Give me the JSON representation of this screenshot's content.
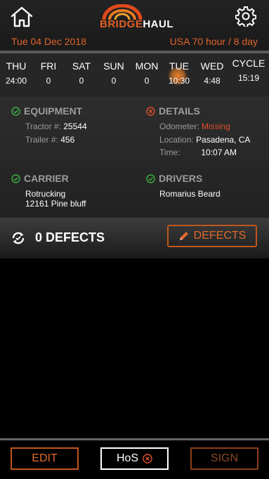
{
  "header": {
    "home_icon": "home-icon",
    "settings_icon": "gear-icon",
    "logo_part1": "BRIDGE",
    "logo_part2": "HAUL",
    "date": "Tue 04 Dec 2018",
    "cycle_rule": "USA 70 hour / 8 day"
  },
  "hours": {
    "days": [
      {
        "name": "THU",
        "value": "24:00"
      },
      {
        "name": "FRI",
        "value": "0"
      },
      {
        "name": "SAT",
        "value": "0"
      },
      {
        "name": "SUN",
        "value": "0"
      },
      {
        "name": "MON",
        "value": "0"
      },
      {
        "name": "TUE",
        "value": "10:30"
      },
      {
        "name": "WED",
        "value": "4:48"
      }
    ],
    "cycle_label": "CYCLE",
    "cycle_value": "15:19"
  },
  "equipment": {
    "title": "EQUIPMENT",
    "tractor_label": "Tractor #:",
    "tractor_value": "25544",
    "trailer_label": "Trailer #:",
    "trailer_value": "456"
  },
  "details": {
    "title": "DETAILS",
    "odometer_label": "Odometer:",
    "odometer_value": "Missing",
    "location_label": "Location:",
    "location_value": "Pasadena, CA",
    "time_label": "Time:",
    "time_value": "10:07 AM"
  },
  "carrier": {
    "title": "CARRIER",
    "name": "Rotrucking",
    "address": "12161 Pine bluff"
  },
  "drivers": {
    "title": "DRIVERS",
    "name": "Romarius Beard"
  },
  "defects": {
    "count_text": "0 DEFECTS",
    "button_label": "DEFECTS"
  },
  "footer": {
    "edit_label": "EDIT",
    "hos_label": "HoS",
    "sign_label": "SIGN"
  },
  "colors": {
    "accent": "#e0642a",
    "ok_green": "#3cb043",
    "error_red": "#e0502a"
  }
}
